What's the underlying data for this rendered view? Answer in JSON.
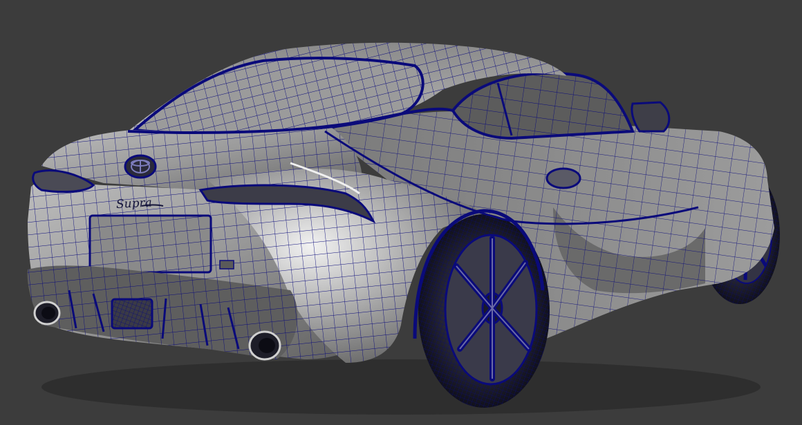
{
  "viewport": {
    "background": "#3c3c3c",
    "subject": "sports-car-rear-three-quarter",
    "render_mode": "shaded-wireframe"
  },
  "colors": {
    "wire": "#0a0a7a",
    "body_light": "#d8d8d8",
    "body_mid": "#8e8e8e",
    "body_dark": "#4a4a4a",
    "glass": "#2b2b2b",
    "tire": "#1c1c2c"
  },
  "car": {
    "badge_script": "Supra",
    "emblem": "toyota-emblem-icon"
  }
}
